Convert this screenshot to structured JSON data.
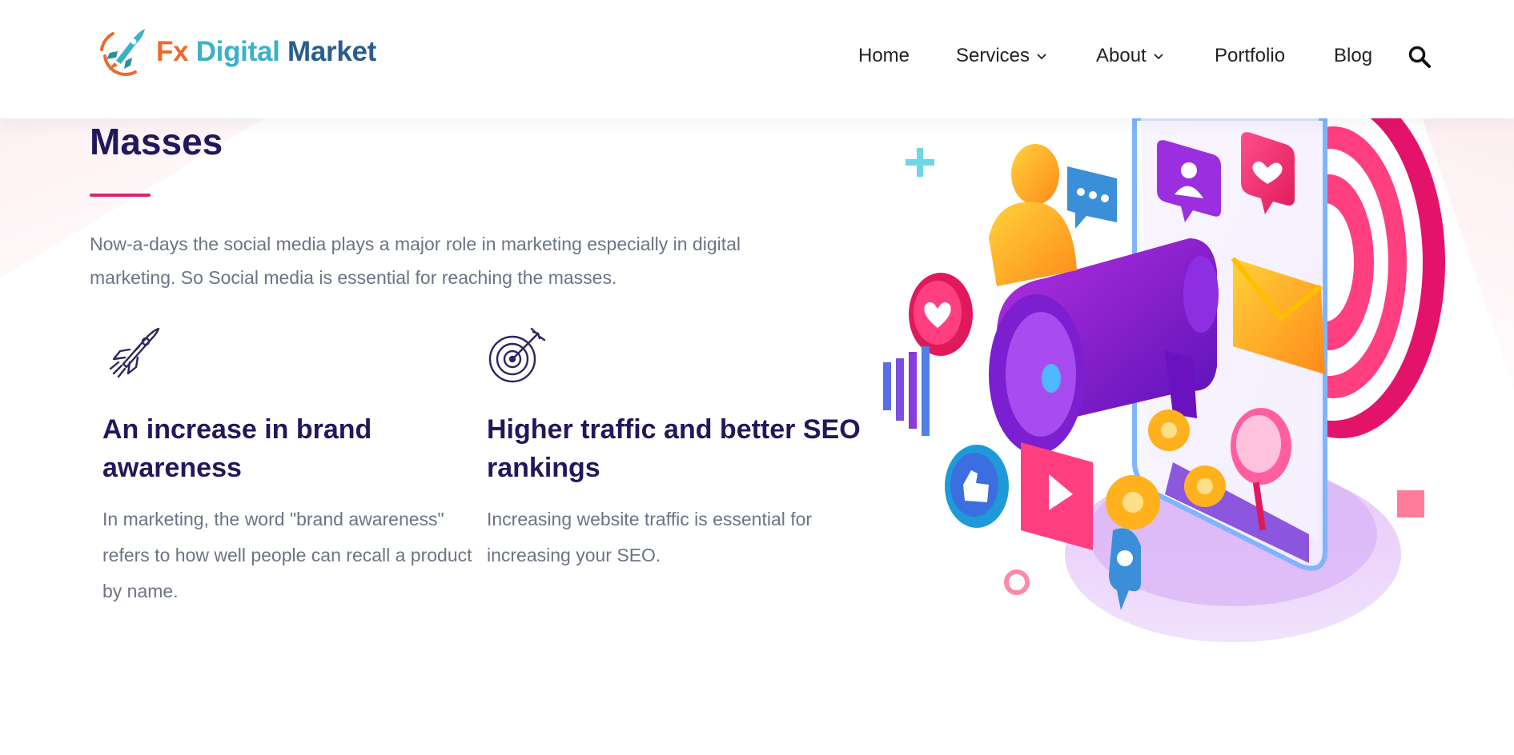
{
  "header": {
    "logo": {
      "part1": "Fx",
      "part2": "Digital",
      "part3": "Market"
    },
    "nav": {
      "home": "Home",
      "services": "Services",
      "about": "About",
      "portfolio": "Portfolio",
      "blog": "Blog"
    }
  },
  "main": {
    "title": "Masses",
    "intro": "Now-a-days the social media plays a major role in marketing especially in digital marketing. So Social media is essential for reaching the masses.",
    "features": [
      {
        "icon": "rocket-icon",
        "title": "An increase in brand awareness",
        "text": "In marketing, the word \"brand awareness\" refers to how well people can recall a product by name."
      },
      {
        "icon": "target-icon",
        "title": "Higher traffic and better SEO rankings",
        "text": "Increasing website traffic is essential for increasing your SEO."
      }
    ]
  },
  "colors": {
    "heading": "#21185c",
    "body_text": "#6b7484",
    "accent_rule": "#d3286b",
    "logo_orange": "#ec6a2b",
    "logo_teal": "#3ab0c9",
    "logo_blue": "#2c5d8a"
  }
}
